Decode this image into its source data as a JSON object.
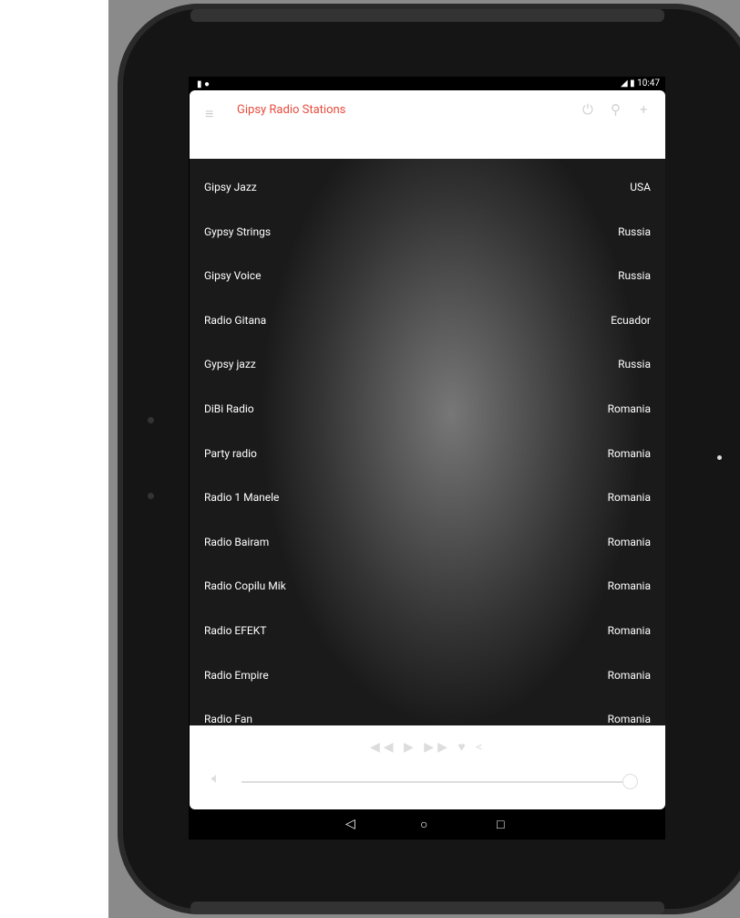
{
  "status_bar": {
    "left_icons": "sd-card-icon android-icon",
    "time": "10:47"
  },
  "app_bar": {
    "title": "Gipsy Radio Stations",
    "title_color": "#e84c3d",
    "actions": [
      "power-icon",
      "search-icon",
      "plus-icon"
    ]
  },
  "stations": [
    {
      "name": "Gipsy Jazz",
      "country": "USA"
    },
    {
      "name": "Gypsy Strings",
      "country": "Russia"
    },
    {
      "name": "Gipsy Voice",
      "country": "Russia"
    },
    {
      "name": "Radio Gitana",
      "country": "Ecuador"
    },
    {
      "name": "Gypsy jazz",
      "country": "Russia"
    },
    {
      "name": "DiBi Radio",
      "country": "Romania"
    },
    {
      "name": "Party radio",
      "country": "Romania"
    },
    {
      "name": "Radio 1 Manele",
      "country": "Romania"
    },
    {
      "name": "Radio Bairam",
      "country": "Romania"
    },
    {
      "name": "Radio Copilu Mik",
      "country": "Romania"
    },
    {
      "name": "Radio EFEKT",
      "country": "Romania"
    },
    {
      "name": "Radio Empire",
      "country": "Romania"
    },
    {
      "name": "Radio Fan",
      "country": "Romania"
    }
  ],
  "player": {
    "volume_percent": 100,
    "controls": [
      "rewind-icon",
      "play-icon",
      "fast-forward-icon",
      "heart-icon",
      "share-icon"
    ]
  }
}
